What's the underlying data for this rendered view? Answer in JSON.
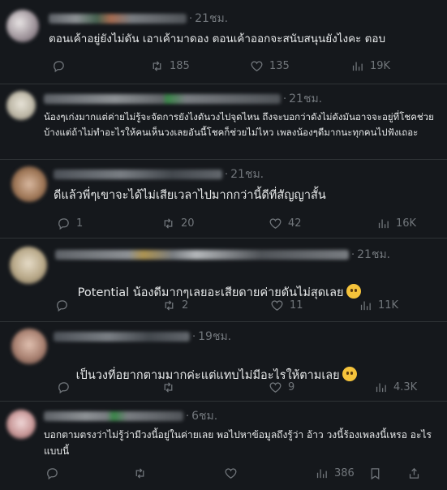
{
  "colors": {
    "background": "#15181c",
    "text": "#e7e9ea",
    "muted": "#71767b",
    "divider": "#2f3336"
  },
  "replies": [
    {
      "separator": "·",
      "time": "21ชม.",
      "text": "ตอนเค้าอยู่ยังไม่ดัน เอาเค้ามาดอง ตอนเค้าออกจะสนับสนุนยังไงคะ ตอบ",
      "reply_count": "",
      "repost_count": "185",
      "like_count": "135",
      "view_count": "19K"
    },
    {
      "separator": "·",
      "time": "21ชม.",
      "text": "น้องๆเก่งมากแต่ค่ายไม่รู้จะจัดการยังไงดันวงไปจุดไหน ถึงจะบอกว่าดังไม่ดังมันอาจจะอยู่ที่โชคช่วยบ้างแต่ถ้าไม่ทำอะไรให้คนเห็นวงเลยอันนี้โชคก็ช่วยไม่ไหว เพลงน้องๆดีมากนะทุกคนไปฟังเถอะ",
      "reply_count": "",
      "repost_count": "",
      "like_count": "",
      "view_count": ""
    },
    {
      "separator": "·",
      "time": "21ชม.",
      "text": "ดีแล้วพี่ๆเขาจะได้ไม่เสียเวลาไปมากกว่านี้ดีที่สัญญาสั้น",
      "reply_count": "1",
      "repost_count": "20",
      "like_count": "42",
      "view_count": "16K"
    },
    {
      "separator": "·",
      "time": "21ชม.",
      "text": "Potential น้องดีมากๆเลยอะเสียดายค่ายดันไม่สุดเลย",
      "emoji": "pleading-face",
      "reply_count": "",
      "repost_count": "2",
      "like_count": "11",
      "view_count": "11K"
    },
    {
      "separator": "·",
      "time": "19ชม.",
      "text": "เป็นวงที่อยากตามมากค่ะแต่แทบไม่มีอะไรให้ตามเลย",
      "emoji": "crying-face",
      "reply_count": "",
      "repost_count": "",
      "like_count": "9",
      "view_count": "4.3K"
    },
    {
      "separator": "·",
      "time": "6ชม.",
      "text": "บอกตามตรงว่าไม่รู้ว่ามีวงนี้อยู่ในค่ายเลย พอไปหาข้อมูลถึงรู้ว่า อ้าว วงนี้ร้องเพลงนี้เหรอ อะไรแบบนี้",
      "reply_count": "",
      "repost_count": "",
      "like_count": "",
      "view_count": "386"
    }
  ]
}
